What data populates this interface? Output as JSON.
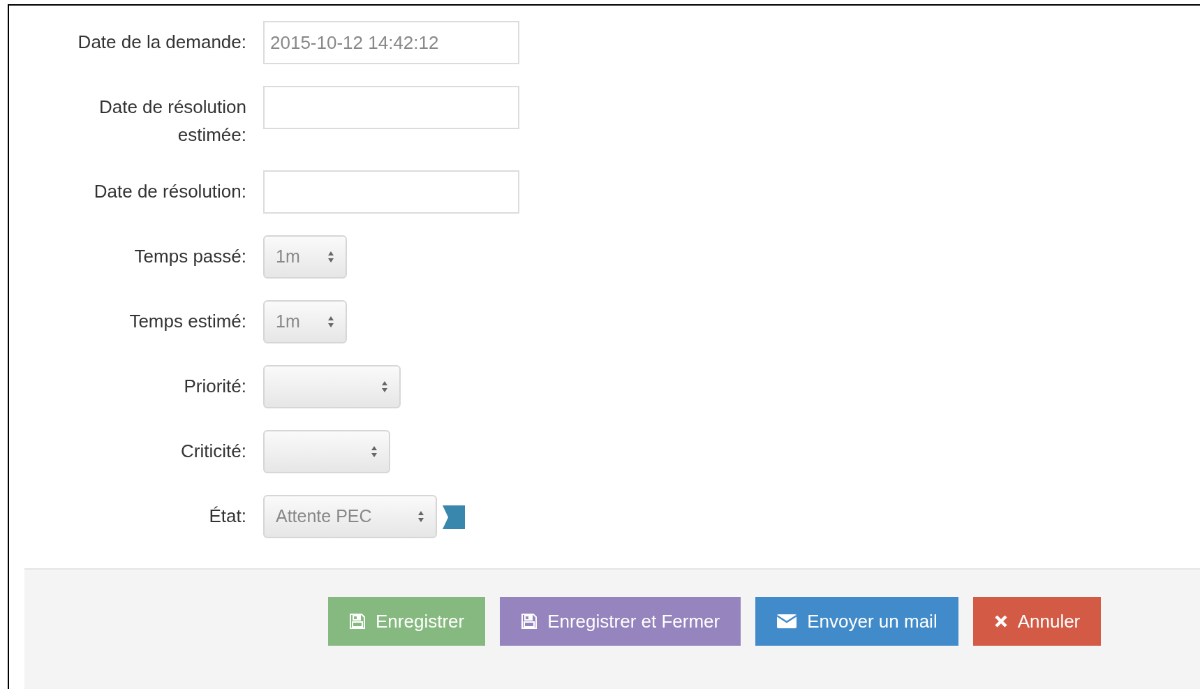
{
  "fields": [
    {
      "kind": "text",
      "label": "Date de la demande:",
      "value": "2015-10-12 14:42:12"
    },
    {
      "kind": "text",
      "label": "Date de résolution estimée:"
    },
    {
      "kind": "text",
      "label": "Date de résolution:"
    },
    {
      "kind": "select",
      "label": "Temps passé:",
      "value": "1m"
    },
    {
      "kind": "select",
      "label": "Temps estimé:",
      "value": "1m"
    },
    {
      "kind": "select",
      "label": "Priorité:"
    },
    {
      "kind": "select",
      "label": "Criticité:"
    },
    {
      "kind": "select",
      "label": "État:",
      "value": "Attente PEC",
      "color": "#3a87ad"
    }
  ],
  "buttons": [
    {
      "label": "Enregistrer",
      "kind": "save",
      "color": "#86b97f"
    },
    {
      "label": "Enregistrer et Fermer",
      "kind": "save",
      "color": "#9584bd"
    },
    {
      "label": "Envoyer un mail",
      "kind": "mail",
      "color": "#428bca"
    },
    {
      "label": "Annuler",
      "kind": "cancel",
      "color": "#d35a45"
    }
  ]
}
